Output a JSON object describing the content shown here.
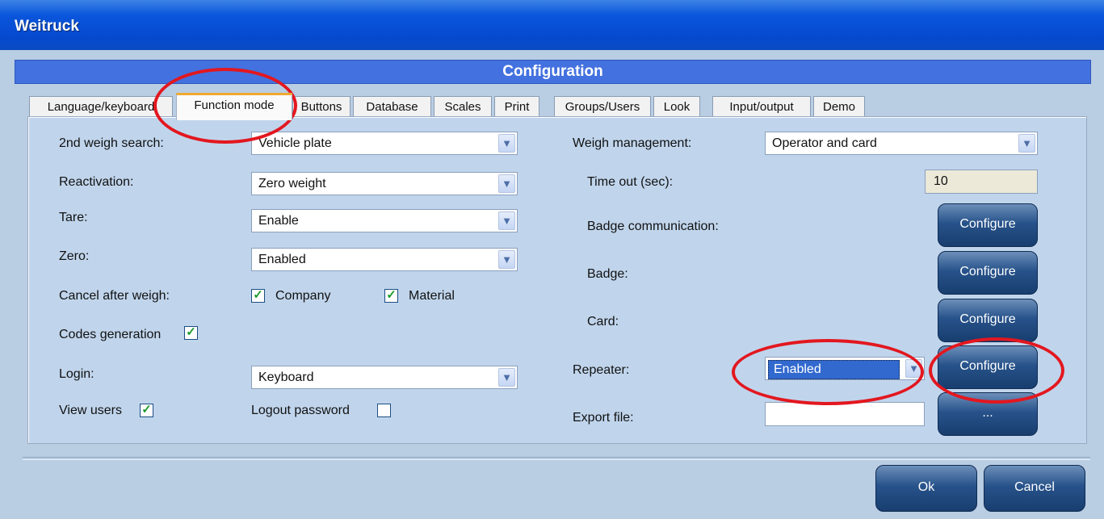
{
  "window": {
    "title": "Weitruck"
  },
  "header": {
    "title": "Configuration"
  },
  "tabs": [
    {
      "label": "Language/keyboard"
    },
    {
      "label": "Function mode"
    },
    {
      "label": "Buttons"
    },
    {
      "label": "Database"
    },
    {
      "label": "Scales"
    },
    {
      "label": "Print"
    },
    {
      "label": "Groups/Users"
    },
    {
      "label": "Look"
    },
    {
      "label": "Input/output"
    },
    {
      "label": "Demo"
    }
  ],
  "left": {
    "second_weigh_search": {
      "label": "2nd weigh search:",
      "value": "Vehicle plate"
    },
    "reactivation": {
      "label": "Reactivation:",
      "value": "Zero weight"
    },
    "tare": {
      "label": "Tare:",
      "value": "Enable"
    },
    "zero": {
      "label": "Zero:",
      "value": "Enabled"
    },
    "cancel_after_weigh": {
      "label": "Cancel after weigh:",
      "company": "Company",
      "material": "Material"
    },
    "codes_generation": {
      "label": "Codes generation"
    },
    "login": {
      "label": "Login:",
      "value": "Keyboard"
    },
    "view_users": {
      "label": "View users"
    },
    "logout_password": {
      "label": "Logout password"
    }
  },
  "right": {
    "weigh_management": {
      "label": "Weigh management:",
      "value": "Operator and card"
    },
    "time_out": {
      "label": "Time out (sec):",
      "value": "10"
    },
    "badge_communication": {
      "label": "Badge communication:",
      "button": "Configure"
    },
    "badge": {
      "label": "Badge:",
      "button": "Configure"
    },
    "card": {
      "label": "Card:",
      "button": "Configure"
    },
    "repeater": {
      "label": "Repeater:",
      "value": "Enabled",
      "button": "Configure"
    },
    "export_file": {
      "label": "Export file:",
      "value": "",
      "button": "..."
    }
  },
  "footer": {
    "ok": "Ok",
    "cancel": "Cancel"
  },
  "checkbox_mark": "✓",
  "dropdown_arrow": "▼",
  "icons": {
    "checkbox": "check-icon",
    "dropdown": "chevron-down-icon"
  },
  "colors": {
    "titlebar": "#0a56dc",
    "header": "#4371df",
    "panel": "#c0d5ec",
    "button": "#27528a",
    "highlight": "#e3171f"
  }
}
